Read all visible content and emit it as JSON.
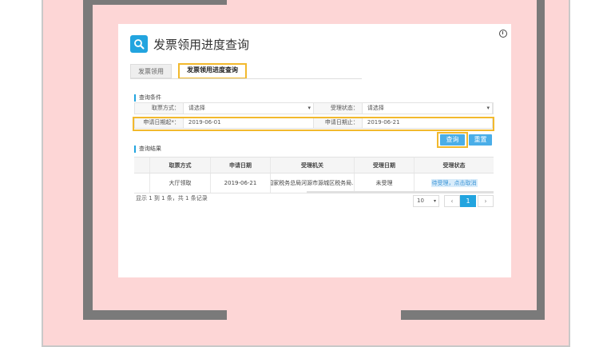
{
  "window": {
    "title": "发票领用进度查询"
  },
  "tabs": [
    {
      "label": "发票领用",
      "active": false
    },
    {
      "label": "发票领用进度查询",
      "active": true
    }
  ],
  "query": {
    "section_title": "查询条件",
    "fetch_method_label": "取票方式：",
    "fetch_method_value": "请选择",
    "status_label": "受理状态：",
    "status_value": "请选择",
    "start_date_label": "申请日期起*：",
    "start_date_value": "2019-06-01",
    "end_date_label": "申请日期止：",
    "end_date_value": "2019-06-21",
    "search_button": "查询",
    "reset_button": "重置"
  },
  "results": {
    "section_title": "查询结果",
    "columns": [
      "取票方式",
      "申请日期",
      "受理机关",
      "受理日期",
      "受理状态"
    ],
    "rows": [
      [
        "大厅领取",
        "2019-06-21",
        "国家税务总局河源市源城区税务局...",
        "未受理",
        "待受理，点击取消"
      ]
    ],
    "summary": "显示 1 到 1 条，共 1 条记录"
  },
  "pager": {
    "page_size": "10",
    "prev": "‹",
    "current_page": "1",
    "next": "›"
  },
  "colors": {
    "accent": "#22a4df",
    "highlight": "#f2b92d",
    "frame_pink": "#fdd6d6",
    "frame_gray": "#7a7a7a"
  }
}
